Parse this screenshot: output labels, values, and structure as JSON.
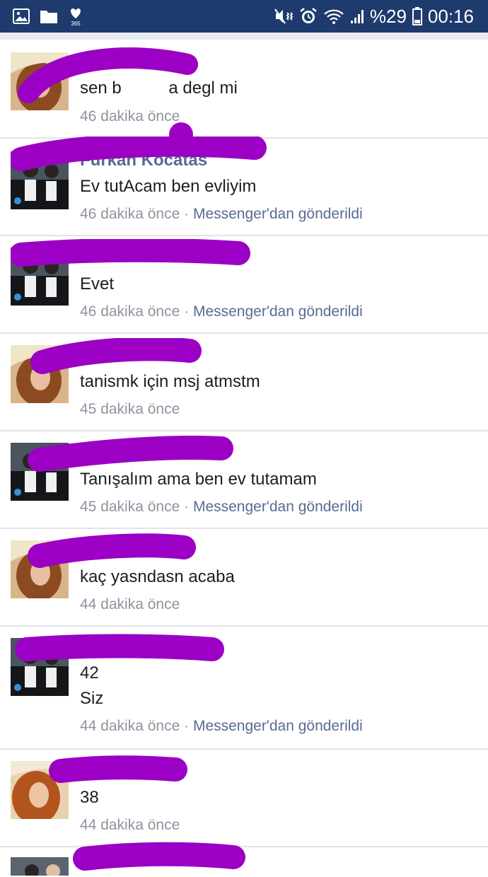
{
  "status_bar": {
    "icons_left": [
      "gallery-icon",
      "folder-icon",
      "health-365-icon"
    ],
    "badge": "365",
    "icons_right": [
      "mute-vibrate-icon",
      "alarm-icon",
      "wifi-icon",
      "signal-icon",
      "battery-icon"
    ],
    "battery": "%29",
    "time": "00:16"
  },
  "messages": [
    {
      "sender": "",
      "text": "sen b          a degl mi",
      "time": "46 dakika önce",
      "via": ""
    },
    {
      "sender": "Furkan Kocatas",
      "text": "Ev tutAcam ben evliyim",
      "time": "46 dakika önce",
      "via": "Messenger'dan gönderildi"
    },
    {
      "sender": "",
      "text": "Evet",
      "time": "46 dakika önce",
      "via": "Messenger'dan gönderildi"
    },
    {
      "sender": "",
      "text": "tanismk için msj atmstm",
      "time": "45 dakika önce",
      "via": ""
    },
    {
      "sender": "",
      "text": "Tanışalım ama ben ev tutamam",
      "time": "45 dakika önce",
      "via": "Messenger'dan gönderildi"
    },
    {
      "sender": "",
      "text": "kaç yasndasn acaba",
      "time": "44 dakika önce",
      "via": ""
    },
    {
      "sender": "",
      "text": "42",
      "text2": "Siz",
      "time": "44 dakika önce",
      "via": "Messenger'dan gönderildi"
    },
    {
      "sender": "",
      "text": "38",
      "time": "44 dakika önce",
      "via": ""
    }
  ],
  "separator": " · ",
  "colors": {
    "status_bar": "#1f3b6d",
    "scribble": "#9b00c4",
    "link": "#576b95",
    "muted": "#8d949e"
  }
}
